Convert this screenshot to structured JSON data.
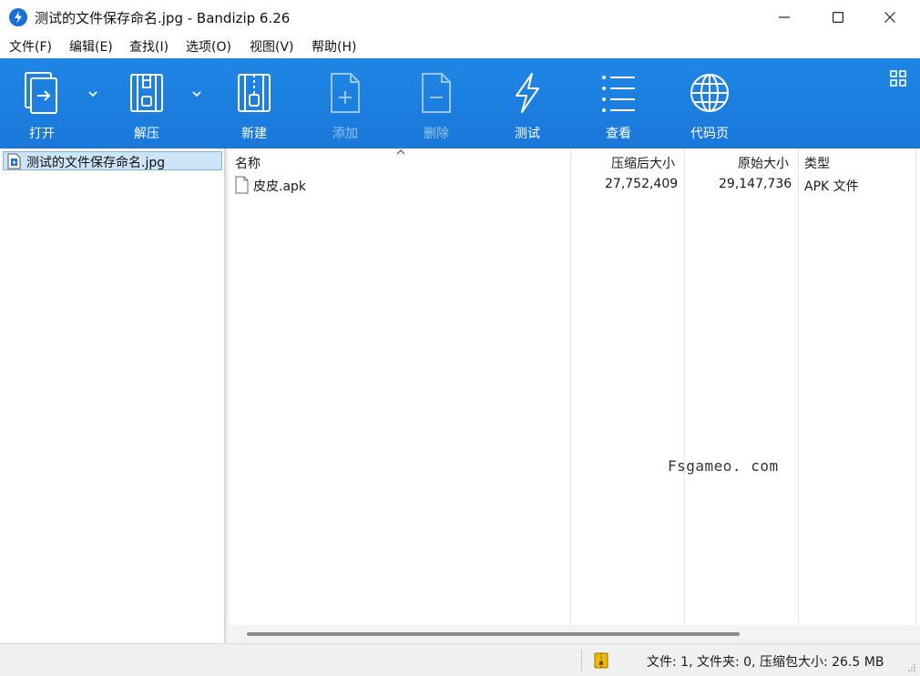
{
  "window": {
    "title": "测试的文件保存命名.jpg - Bandizip 6.26"
  },
  "menu": {
    "items": [
      "文件(F)",
      "编辑(E)",
      "查找(I)",
      "选项(O)",
      "视图(V)",
      "帮助(H)"
    ]
  },
  "toolbar": {
    "open": "打开",
    "extract": "解压",
    "new": "新建",
    "add": "添加",
    "delete": "删除",
    "test": "测试",
    "view": "查看",
    "codepage": "代码页"
  },
  "tree": {
    "selected": "测试的文件保存命名.jpg"
  },
  "filelist": {
    "columns": {
      "name": "名称",
      "compressed": "压缩后大小",
      "original": "原始大小",
      "type": "类型"
    },
    "rows": [
      {
        "name": "皮皮.apk",
        "compressed": "27,752,409",
        "original": "29,147,736",
        "type": "APK 文件"
      }
    ]
  },
  "watermark": "Fsgameo. com",
  "status": {
    "text": "文件: 1, 文件夹: 0, 压缩包大小: 26.5 MB"
  },
  "colors": {
    "toolbar": "#1f86e6",
    "selection": "#cde4f7"
  }
}
